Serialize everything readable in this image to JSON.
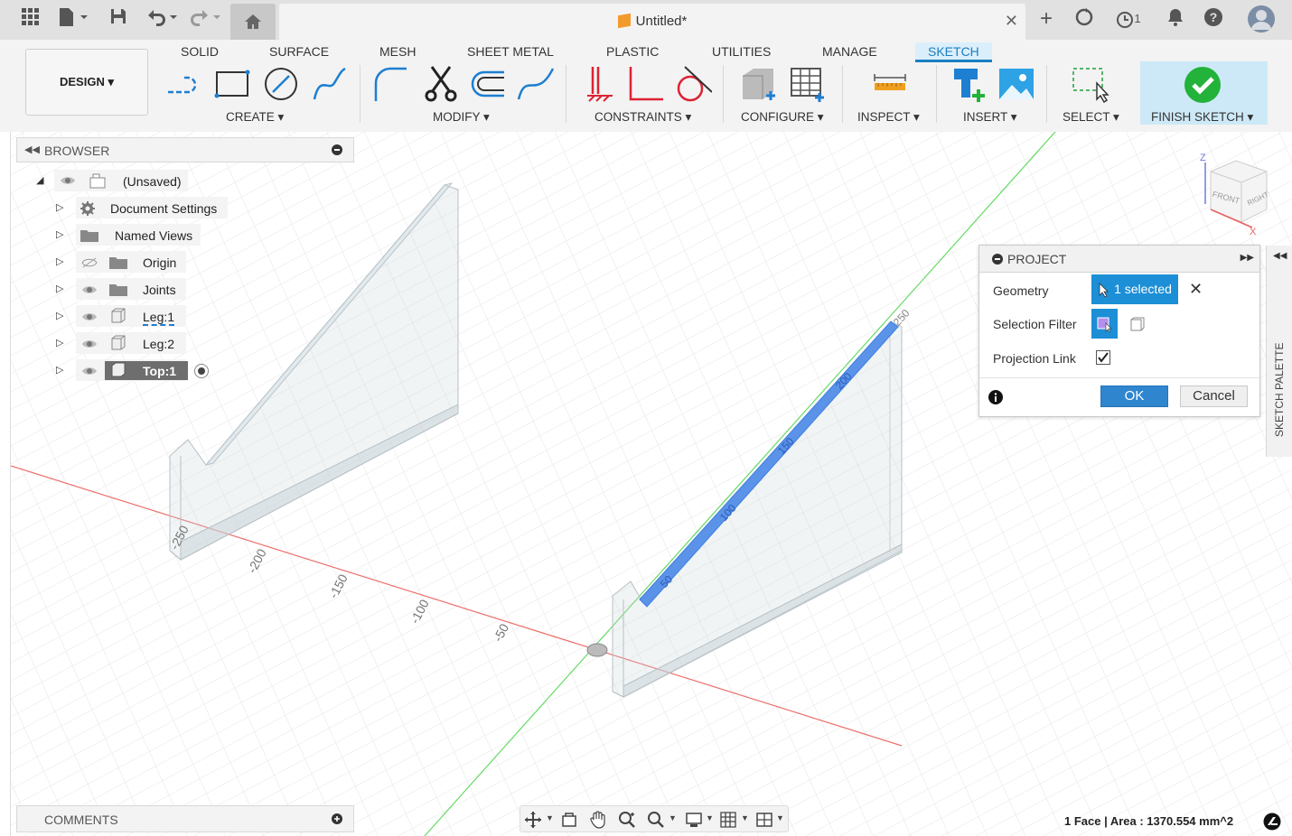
{
  "topbar": {
    "document_title": "Untitled*",
    "job_count": "1",
    "icons": [
      "grid-icon",
      "file-icon",
      "save-icon",
      "undo-icon",
      "redo-icon",
      "home-icon",
      "new-tab-icon",
      "sync-icon",
      "jobs-icon",
      "notifications-icon",
      "help-icon",
      "avatar"
    ]
  },
  "toolbar": {
    "workspace": "DESIGN",
    "tabs": [
      "SOLID",
      "SURFACE",
      "MESH",
      "SHEET METAL",
      "PLASTIC",
      "UTILITIES",
      "MANAGE",
      "SKETCH"
    ],
    "active_tab": "SKETCH",
    "groups": {
      "create": "CREATE",
      "modify": "MODIFY",
      "constraints": "CONSTRAINTS",
      "configure": "CONFIGURE",
      "inspect": "INSPECT",
      "insert": "INSERT",
      "select": "SELECT",
      "finish": "FINISH SKETCH"
    },
    "dropdown_glyph": "▾"
  },
  "browser": {
    "title": "BROWSER",
    "items": [
      {
        "label": "(Unsaved)"
      },
      {
        "label": "Document Settings"
      },
      {
        "label": "Named Views"
      },
      {
        "label": "Origin"
      },
      {
        "label": "Joints"
      },
      {
        "label": "Leg:1"
      },
      {
        "label": "Leg:2"
      },
      {
        "label": "Top:1"
      }
    ]
  },
  "viewcube": {
    "front": "FRONT",
    "right": "RIGHT",
    "z": "Z",
    "x": "X"
  },
  "axis_ticks": {
    "left_leg": [
      "-250",
      "-200",
      "-150",
      "-100",
      "-50"
    ],
    "selected_edge": [
      "50",
      "100",
      "150",
      "200",
      "250"
    ]
  },
  "dialog": {
    "title": "PROJECT",
    "geometry_label": "Geometry",
    "geometry_value": "1 selected",
    "selection_filter_label": "Selection Filter",
    "projection_link_label": "Projection Link",
    "projection_link_checked": true,
    "ok": "OK",
    "cancel": "Cancel"
  },
  "sketch_palette": "SKETCH PALETTE",
  "comments": {
    "title": "COMMENTS"
  },
  "status": {
    "text": "1 Face | Area : 1370.554 mm^2"
  },
  "colors": {
    "accent": "#1a7fc1",
    "selection": "#5b93e8",
    "finish_green": "#23b23a",
    "x_axis": "#e8403a",
    "y_axis": "#3fd13f"
  }
}
